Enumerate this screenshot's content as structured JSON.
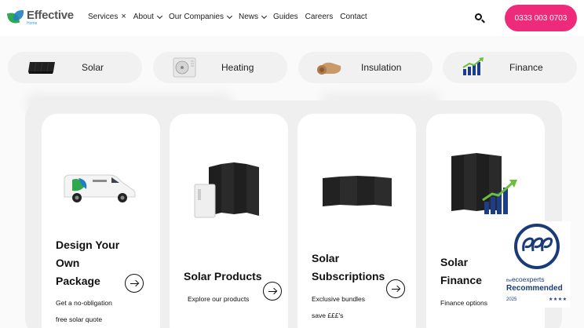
{
  "logo": {
    "title": "Effective",
    "subtitle": "Home"
  },
  "nav": {
    "services": "Services",
    "services_close": "×",
    "about": "About",
    "our_companies": "Our Companies",
    "news": "News",
    "guides": "Guides",
    "careers": "Careers",
    "contact": "Contact"
  },
  "phone": "0333 003 0703",
  "categories": [
    {
      "label": "Solar",
      "icon": "solar-panel-icon"
    },
    {
      "label": "Heating",
      "icon": "heat-pump-icon"
    },
    {
      "label": "Insulation",
      "icon": "insulation-roll-icon"
    },
    {
      "label": "Finance",
      "icon": "finance-chart-icon"
    }
  ],
  "cards": [
    {
      "title_lines": [
        "Design Your",
        "Own",
        "Package"
      ],
      "desc_lines": [
        "Get a no-obligation",
        "free solar quote"
      ]
    },
    {
      "title_lines": [
        "Solar Products"
      ],
      "desc_lines": [
        "Explore our products"
      ]
    },
    {
      "title_lines": [
        "Solar",
        "Subscriptions"
      ],
      "desc_lines": [
        "Exclusive bundles",
        "save £££'s"
      ]
    },
    {
      "title_lines": [
        "Solar",
        "Finance"
      ],
      "desc_lines": [
        "Finance options"
      ]
    }
  ],
  "eco_badge": {
    "prefix": "the",
    "name": "ecoexperts",
    "recommended": "Recommended",
    "year": "2025",
    "stars": "★★★★"
  },
  "colors": {
    "brand_pink": "#ee2a7b",
    "eco_navy": "#1a3b7a",
    "card_bg": "#ffffff",
    "panel_bg": "#efefef"
  }
}
